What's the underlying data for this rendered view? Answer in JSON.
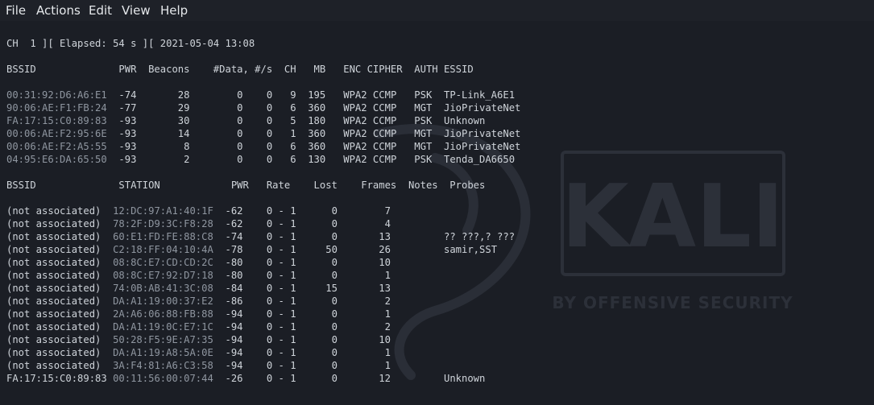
{
  "menu": {
    "items": [
      "File",
      "Actions",
      "Edit",
      "View",
      "Help"
    ]
  },
  "watermark": {
    "title": "KALI",
    "subtitle": "BY OFFENSIVE SECURITY"
  },
  "terminal": {
    "status_line": "CH  1 ][ Elapsed: 54 s ][ 2021-05-04 13:08",
    "ap_header": "BSSID              PWR  Beacons    #Data, #/s  CH   MB   ENC CIPHER  AUTH ESSID",
    "ap_rows": [
      {
        "bssid": "00:31:92:D6:A6:E1",
        "rest": "  -74       28        0    0   9  195   WPA2 CCMP   PSK  TP-Link_A6E1"
      },
      {
        "bssid": "90:06:AE:F1:FB:24",
        "rest": "  -77       29        0    0   6  360   WPA2 CCMP   MGT  JioPrivateNet"
      },
      {
        "bssid": "FA:17:15:C0:89:83",
        "rest": "  -93       30        0    0   5  180   WPA2 CCMP   PSK  Unknown"
      },
      {
        "bssid": "00:06:AE:F2:95:6E",
        "rest": "  -93       14        0    0   1  360   WPA2 CCMP   MGT  JioPrivateNet"
      },
      {
        "bssid": "00:06:AE:F2:A5:55",
        "rest": "  -93        8        0    0   6  360   WPA2 CCMP   MGT  JioPrivateNet"
      },
      {
        "bssid": "04:95:E6:DA:65:50",
        "rest": "  -93        2        0    0   6  130   WPA2 CCMP   PSK  Tenda_DA6650"
      }
    ],
    "sta_header": "BSSID              STATION            PWR   Rate    Lost    Frames  Notes  Probes",
    "sta_rows": [
      {
        "bssid": "(not associated)  ",
        "station": "12:DC:97:A1:40:1F",
        "rest": "  -62    0 - 1      0        7"
      },
      {
        "bssid": "(not associated)  ",
        "station": "78:2F:D9:3C:F8:28",
        "rest": "  -62    0 - 1      0        4"
      },
      {
        "bssid": "(not associated)  ",
        "station": "60:E1:FD:FE:88:C8",
        "rest": "  -74    0 - 1      0       13         ?? ???,? ???"
      },
      {
        "bssid": "(not associated)  ",
        "station": "C2:18:FF:04:10:4A",
        "rest": "  -78    0 - 1     50       26         samir,SST"
      },
      {
        "bssid": "(not associated)  ",
        "station": "08:8C:E7:CD:CD:2C",
        "rest": "  -80    0 - 1      0       10"
      },
      {
        "bssid": "(not associated)  ",
        "station": "08:8C:E7:92:D7:18",
        "rest": "  -80    0 - 1      0        1"
      },
      {
        "bssid": "(not associated)  ",
        "station": "74:0B:AB:41:3C:08",
        "rest": "  -84    0 - 1     15       13"
      },
      {
        "bssid": "(not associated)  ",
        "station": "DA:A1:19:00:37:E2",
        "rest": "  -86    0 - 1      0        2"
      },
      {
        "bssid": "(not associated)  ",
        "station": "2A:A6:06:88:FB:88",
        "rest": "  -94    0 - 1      0        1"
      },
      {
        "bssid": "(not associated)  ",
        "station": "DA:A1:19:0C:E7:1C",
        "rest": "  -94    0 - 1      0        2"
      },
      {
        "bssid": "(not associated)  ",
        "station": "50:28:F5:9E:A7:35",
        "rest": "  -94    0 - 1      0       10"
      },
      {
        "bssid": "(not associated)  ",
        "station": "DA:A1:19:A8:5A:0E",
        "rest": "  -94    0 - 1      0        1"
      },
      {
        "bssid": "(not associated)  ",
        "station": "3A:F4:81:A6:C3:58",
        "rest": "  -94    0 - 1      0        1"
      },
      {
        "bssid": "FA:17:15:C0:89:83 ",
        "station": "00:11:56:00:07:44",
        "rest": "  -26    0 - 1      0       12         Unknown"
      }
    ]
  }
}
